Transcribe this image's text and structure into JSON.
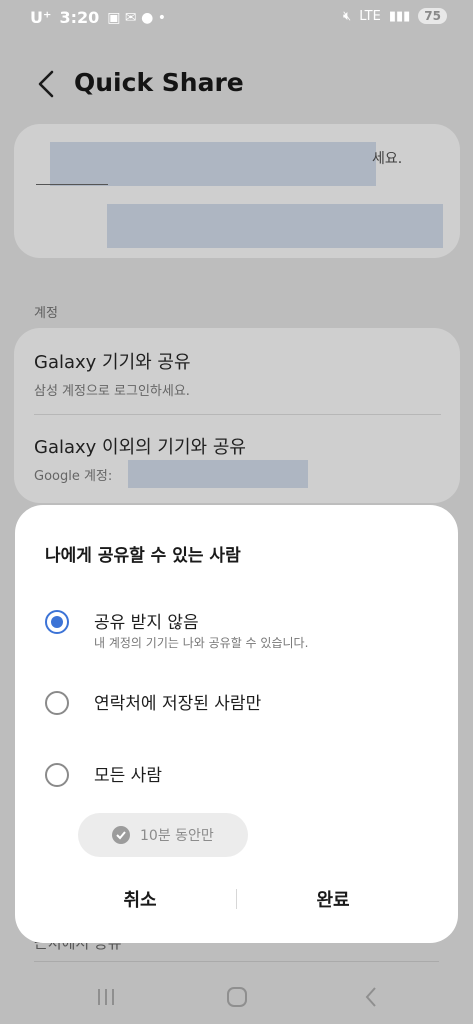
{
  "status_bar": {
    "carrier": "U⁺",
    "time": "3:20",
    "network": "LTE",
    "battery": "75"
  },
  "header": {
    "title": "Quick Share"
  },
  "info_card": {
    "visible_suffix": "세요."
  },
  "account_section": {
    "label": "계정",
    "items": [
      {
        "title": "Galaxy 기기와 공유",
        "subtitle": "삼성 계정으로 로그인하세요."
      },
      {
        "title": "Galaxy 이외의 기기와 공유",
        "subtitle": "Google 계정:"
      }
    ]
  },
  "peek_text": "근처에서 공유",
  "dialog": {
    "title": "나에게 공유할 수 있는 사람",
    "options": [
      {
        "label": "공유 받지 않음",
        "sublabel": "내 계정의 기기는 나와 공유할 수 있습니다.",
        "selected": true
      },
      {
        "label": "연락처에 저장된 사람만",
        "selected": false
      },
      {
        "label": "모든 사람",
        "selected": false
      }
    ],
    "timer_chip": "10분 동안만",
    "cancel": "취소",
    "done": "완료"
  },
  "colors": {
    "accent": "#3c73d6",
    "overlay_bg": "#bdbdbd",
    "redaction": "#aeb6c2"
  }
}
